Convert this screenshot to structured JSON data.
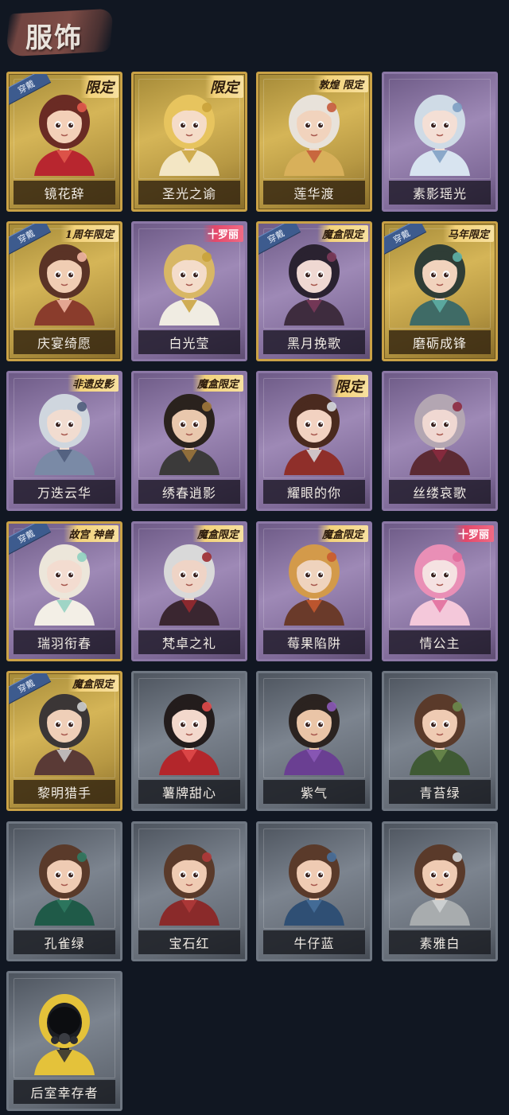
{
  "page": {
    "title": "服饰"
  },
  "labels": {
    "wear": "穿戴"
  },
  "cards": [
    {
      "name": "镜花辞",
      "rarity": "gold",
      "equipped": true,
      "tag": "限定",
      "tag_style": "gold-xl",
      "portrait": {
        "skin": "#f3d0b8",
        "hair": "#6a2b24",
        "outfit": "#b8262f",
        "accent": "#e25a4c"
      }
    },
    {
      "name": "圣光之谕",
      "rarity": "gold",
      "equipped": false,
      "tag": "限定",
      "tag_style": "gold-xl",
      "portrait": {
        "skin": "#f5dcc8",
        "hair": "#e7c45e",
        "outfit": "#f3e6c4",
        "accent": "#c9a23b"
      }
    },
    {
      "name": "莲华渡",
      "rarity": "gold",
      "equipped": false,
      "tag": "敦煌 限定",
      "tag_style": "gold",
      "portrait": {
        "skin": "#f1d3bd",
        "hair": "#e8e2da",
        "outfit": "#d8b05a",
        "accent": "#c55a3a"
      }
    },
    {
      "name": "素影瑶光",
      "rarity": "purple",
      "equipped": false,
      "tag": "",
      "tag_style": "",
      "portrait": {
        "skin": "#f4dfd5",
        "hair": "#cfdbe6",
        "outfit": "#d8e4f0",
        "accent": "#7c9dc2"
      }
    },
    {
      "name": "庆宴绮愿",
      "rarity": "gold",
      "equipped": true,
      "tag": "1周年限定",
      "tag_style": "gold",
      "portrait": {
        "skin": "#f0cdb3",
        "hair": "#5a3326",
        "outfit": "#8a3c2c",
        "accent": "#f3b8a4"
      }
    },
    {
      "name": "白光莹",
      "rarity": "purple",
      "equipped": false,
      "tag": "十罗丽",
      "tag_style": "red",
      "portrait": {
        "skin": "#f4dcca",
        "hair": "#d8b765",
        "outfit": "#f0ece2",
        "accent": "#c9a23b"
      }
    },
    {
      "name": "黑月挽歌",
      "rarity": "purple",
      "equipped": true,
      "tag": "魔盒限定",
      "tag_style": "gold",
      "portrait": {
        "skin": "#efd8d2",
        "hair": "#2a2230",
        "outfit": "#3e2c3e",
        "accent": "#7c3a5a"
      }
    },
    {
      "name": "磨砺成锋",
      "rarity": "gold",
      "equipped": true,
      "tag": "马年限定",
      "tag_style": "gold",
      "portrait": {
        "skin": "#f1d3bd",
        "hair": "#2f3d36",
        "outfit": "#3f6b66",
        "accent": "#5fb3a8"
      }
    },
    {
      "name": "万迭云华",
      "rarity": "purple",
      "equipped": false,
      "tag": "非遗皮影",
      "tag_style": "gold",
      "portrait": {
        "skin": "#f1dcd0",
        "hair": "#cfd6de",
        "outfit": "#7a8aa6",
        "accent": "#4d5b7a"
      }
    },
    {
      "name": "绣春逍影",
      "rarity": "purple",
      "equipped": false,
      "tag": "魔盒限定",
      "tag_style": "gold",
      "portrait": {
        "skin": "#e9c8ad",
        "hair": "#2a221d",
        "outfit": "#3b3a3a",
        "accent": "#a0783c"
      }
    },
    {
      "name": "耀眼的你",
      "rarity": "purple",
      "equipped": false,
      "tag": "限定",
      "tag_style": "gold-xl",
      "portrait": {
        "skin": "#f2d2c1",
        "hair": "#4a2a1f",
        "outfit": "#8f2f2a",
        "accent": "#d9dde2"
      }
    },
    {
      "name": "丝缕哀歌",
      "rarity": "purple",
      "equipped": false,
      "tag": "",
      "tag_style": "",
      "portrait": {
        "skin": "#f0d8d2",
        "hair": "#b3a6b2",
        "outfit": "#5c2a33",
        "accent": "#8c2a3f"
      }
    },
    {
      "name": "瑞羽衔春",
      "rarity": "purple",
      "equipped": true,
      "tag": "故宫 神兽",
      "tag_style": "gold",
      "portrait": {
        "skin": "#f3dcd0",
        "hair": "#ece6da",
        "outfit": "#f3efe6",
        "accent": "#8fd0c0"
      }
    },
    {
      "name": "梵卓之礼",
      "rarity": "purple",
      "equipped": false,
      "tag": "魔盒限定",
      "tag_style": "gold",
      "portrait": {
        "skin": "#efd4c6",
        "hair": "#d9d9d9",
        "outfit": "#3a2630",
        "accent": "#9b2a2f"
      }
    },
    {
      "name": "莓果陷阱",
      "rarity": "purple",
      "equipped": false,
      "tag": "魔盒限定",
      "tag_style": "gold",
      "portrait": {
        "skin": "#efd3bd",
        "hair": "#d39a4a",
        "outfit": "#6a3a2a",
        "accent": "#c95a2f"
      }
    },
    {
      "name": "情公主",
      "rarity": "purple",
      "equipped": false,
      "tag": "十罗丽",
      "tag_style": "red",
      "portrait": {
        "skin": "#f5e2e2",
        "hair": "#e98fb6",
        "outfit": "#f4c8da",
        "accent": "#e06a9a"
      }
    },
    {
      "name": "黎明猎手",
      "rarity": "gold",
      "equipped": true,
      "tag": "魔盒限定",
      "tag_style": "gold",
      "portrait": {
        "skin": "#efcfb8",
        "hair": "#3b3636",
        "outfit": "#5a3a36",
        "accent": "#cfcfcf"
      }
    },
    {
      "name": "薯牌甜心",
      "rarity": "gray",
      "equipped": false,
      "tag": "",
      "tag_style": "",
      "portrait": {
        "skin": "#f3d8cc",
        "hair": "#231c1c",
        "outfit": "#b3262b",
        "accent": "#e24b4b"
      }
    },
    {
      "name": "紫气",
      "rarity": "gray",
      "equipped": false,
      "tag": "",
      "tag_style": "",
      "portrait": {
        "skin": "#eac5a7",
        "hair": "#2b2320",
        "outfit": "#6a3f92",
        "accent": "#8c5ab8"
      }
    },
    {
      "name": "青苔绿",
      "rarity": "gray",
      "equipped": false,
      "tag": "",
      "tag_style": "",
      "portrait": {
        "skin": "#efcbb3",
        "hair": "#5a3a2a",
        "outfit": "#3f5a34",
        "accent": "#6b8a4c"
      }
    },
    {
      "name": "孔雀绿",
      "rarity": "gray",
      "equipped": false,
      "tag": "",
      "tag_style": "",
      "portrait": {
        "skin": "#efcbb3",
        "hair": "#5a3a2a",
        "outfit": "#1f5a48",
        "accent": "#2f7a62"
      }
    },
    {
      "name": "宝石红",
      "rarity": "gray",
      "equipped": false,
      "tag": "",
      "tag_style": "",
      "portrait": {
        "skin": "#efcbb3",
        "hair": "#5a3a2a",
        "outfit": "#8a2a2a",
        "accent": "#b03a3a"
      }
    },
    {
      "name": "牛仔蓝",
      "rarity": "gray",
      "equipped": false,
      "tag": "",
      "tag_style": "",
      "portrait": {
        "skin": "#efcbb3",
        "hair": "#5a3a2a",
        "outfit": "#2f4f74",
        "accent": "#47709c"
      }
    },
    {
      "name": "素雅白",
      "rarity": "gray",
      "equipped": false,
      "tag": "",
      "tag_style": "",
      "portrait": {
        "skin": "#efcbb3",
        "hair": "#5a3a2a",
        "outfit": "#a8acae",
        "accent": "#d2d5d6"
      }
    },
    {
      "name": "后室幸存者",
      "rarity": "gray",
      "equipped": false,
      "tag": "",
      "tag_style": "",
      "portrait": {
        "skin": "#1b1d22",
        "hair": "#e4c23a",
        "outfit": "#e4c23a",
        "accent": "#2a2c31"
      }
    }
  ]
}
